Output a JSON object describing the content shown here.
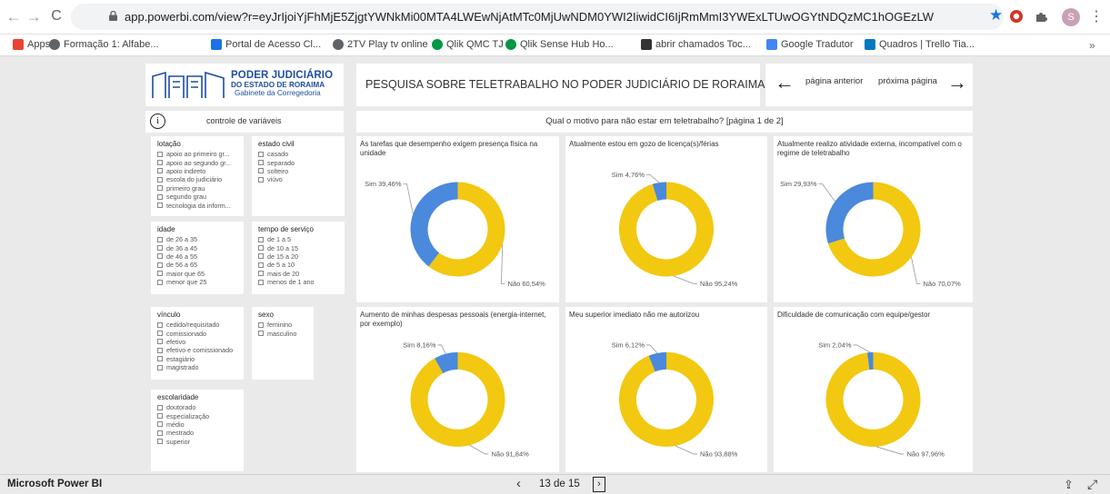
{
  "browser": {
    "url": "app.powerbi.com/view?r=eyJrIjoiYjFhMjE5ZjgtYWNkMi00MTA4LWEwNjAtMTc0MjUwNDM0YWI2IiwidCI6IjRmMmI3YWExLTUwOGYtNDQzMC1hOGEzLWQ4YzFmZTA2Z...",
    "avatar_letter": "S",
    "bookmarks": [
      {
        "label": "Apps",
        "color": "#4285f4"
      },
      {
        "label": "Formação 1: Alfabe...",
        "color": "#5f6368"
      },
      {
        "label": "Portal de Acesso Cl...",
        "color": "#1a73e8"
      },
      {
        "label": "2TV Play tv online",
        "color": "#5f6368"
      },
      {
        "label": "Qlik QMC TJ",
        "color": "#009845"
      },
      {
        "label": "Qlik Sense Hub Ho...",
        "color": "#009845"
      },
      {
        "label": "abrir chamados Toc...",
        "color": "#333333"
      },
      {
        "label": "Google Tradutor",
        "color": "#4285f4"
      },
      {
        "label": "Quadros | Trello Tia...",
        "color": "#0079bf"
      }
    ]
  },
  "report": {
    "logo_line1": "PODER JUDICIÁRIO",
    "logo_line2": "DO ESTADO DE RORAIMA",
    "logo_line3": "Gabinete da Corregedoria",
    "title": "PESQUISA SOBRE TELETRABALHO NO PODER JUDICIÁRIO DE RORAIMA",
    "prev_page": "página anterior",
    "next_page": "próxima página",
    "controls_label": "controle de variáveis",
    "question": "Qual o motivo para não estar em teletrabalho? [página 1 de 2]"
  },
  "slicers": {
    "lotacao": {
      "title": "lotação",
      "items": [
        "apoio ao primeiro gr...",
        "apoio ao segundo gr...",
        "apoio indireto",
        "escola do judiciário",
        "primeiro grau",
        "segundo grau",
        "tecnologia da inform..."
      ]
    },
    "estado_civil": {
      "title": "estado civil",
      "items": [
        "casado",
        "separado",
        "solteiro",
        "viúvo"
      ]
    },
    "idade": {
      "title": "idade",
      "items": [
        "de 26 a 35",
        "de 36 a 45",
        "de 46 a 55",
        "de 56 a 65",
        "maior que 65",
        "menor que 25"
      ]
    },
    "tempo": {
      "title": "tempo de serviço",
      "items": [
        "de 1 a 5",
        "de 10 a 15",
        "de 15 a 20",
        "de 5 a 10",
        "mais de 20",
        "menos de 1 ano"
      ]
    },
    "vinculo": {
      "title": "vínculo",
      "items": [
        "cedido/requisitado",
        "comissionado",
        "efetivo",
        "efetivo e comissionado",
        "estagiário",
        "magistrado"
      ]
    },
    "sexo": {
      "title": "sexo",
      "items": [
        "feminino",
        "masculino"
      ]
    },
    "escolaridade": {
      "title": "escolaridade",
      "items": [
        "doutorado",
        "especialização",
        "médio",
        "mestrado",
        "superior"
      ]
    }
  },
  "colors": {
    "sim": "#4a89dc",
    "nao": "#f2c811"
  },
  "chart_data": [
    {
      "type": "pie",
      "title": "As tarefas que desempenho exigem presença física na unidade",
      "labels": [
        "Sim",
        "Não"
      ],
      "values": [
        39.46,
        60.54
      ],
      "data_labels": [
        "Sim 39,46%",
        "Não 60,54%"
      ]
    },
    {
      "type": "pie",
      "title": "Atualmente estou em gozo de licença(s)/férias",
      "labels": [
        "Sim",
        "Não"
      ],
      "values": [
        4.76,
        95.24
      ],
      "data_labels": [
        "Sim 4,76%",
        "Não 95,24%"
      ]
    },
    {
      "type": "pie",
      "title": "Atualmente realizo atividade externa, incompatível com o regime de teletrabalho",
      "labels": [
        "Sim",
        "Não"
      ],
      "values": [
        29.93,
        70.07
      ],
      "data_labels": [
        "Sim 29,93%",
        "Não 70,07%"
      ]
    },
    {
      "type": "pie",
      "title": "Aumento de minhas despesas pessoais (energia-internet, por exemplo)",
      "labels": [
        "Sim",
        "Não"
      ],
      "values": [
        8.16,
        91.84
      ],
      "data_labels": [
        "Sim 8,16%",
        "Não 91,84%"
      ]
    },
    {
      "type": "pie",
      "title": "Meu superior imediato não me autorizou",
      "labels": [
        "Sim",
        "Não"
      ],
      "values": [
        6.12,
        93.88
      ],
      "data_labels": [
        "Sim 6,12%",
        "Não 93,88%"
      ]
    },
    {
      "type": "pie",
      "title": "Dificuldade de comunicação com equipe/gestor",
      "labels": [
        "Sim",
        "Não"
      ],
      "values": [
        2.04,
        97.96
      ],
      "data_labels": [
        "Sim 2,04%",
        "Não 97,96%"
      ]
    }
  ],
  "footer": {
    "brand": "Microsoft Power BI",
    "pager": "13 de 15"
  }
}
